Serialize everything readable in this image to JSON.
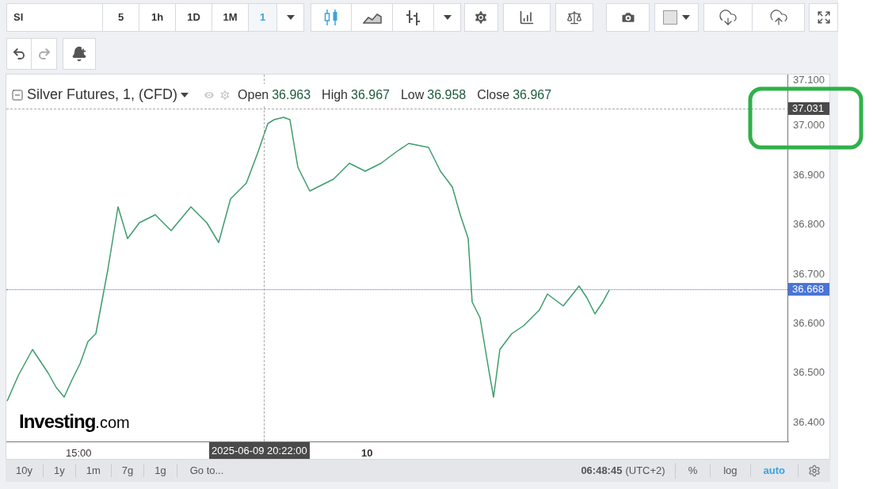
{
  "toolbar": {
    "symbol": "SI",
    "intervals": [
      {
        "label": "5",
        "selected": false
      },
      {
        "label": "1h",
        "selected": false
      },
      {
        "label": "1D",
        "selected": false
      },
      {
        "label": "1M",
        "selected": false
      },
      {
        "label": "1",
        "selected": true
      }
    ],
    "chart_types": [
      {
        "kind": "candles",
        "selected": true
      },
      {
        "kind": "area",
        "selected": false
      },
      {
        "kind": "bars",
        "selected": false
      }
    ]
  },
  "chart": {
    "title": "Silver Futures, 1, (CFD)",
    "ohlc": [
      {
        "label": "Open",
        "value": "36.963"
      },
      {
        "label": "High",
        "value": "36.967"
      },
      {
        "label": "Low",
        "value": "36.958"
      },
      {
        "label": "Close",
        "value": "36.967"
      }
    ],
    "price_ticks": [
      "37.100",
      "37.000",
      "36.900",
      "36.800",
      "36.700",
      "36.600",
      "36.500",
      "36.400"
    ],
    "crosshair_price": "37.031",
    "last_price": "36.668",
    "time_labels": [
      {
        "text": "15:00",
        "bold": false
      },
      {
        "text": "10",
        "bold": true
      }
    ],
    "crosshair_time": "2025-06-09 20:22:00",
    "logo": {
      "name": "Investing",
      "suffix": ".com"
    }
  },
  "bottom_bar": {
    "ranges": [
      "10y",
      "1y",
      "1m",
      "7g",
      "1g"
    ],
    "goto": "Go to...",
    "time": "06:48:45",
    "timezone": "(UTC+2)",
    "options": [
      {
        "label": "%",
        "selected": false
      },
      {
        "label": "log",
        "selected": false
      },
      {
        "label": "auto",
        "selected": true
      }
    ]
  }
}
